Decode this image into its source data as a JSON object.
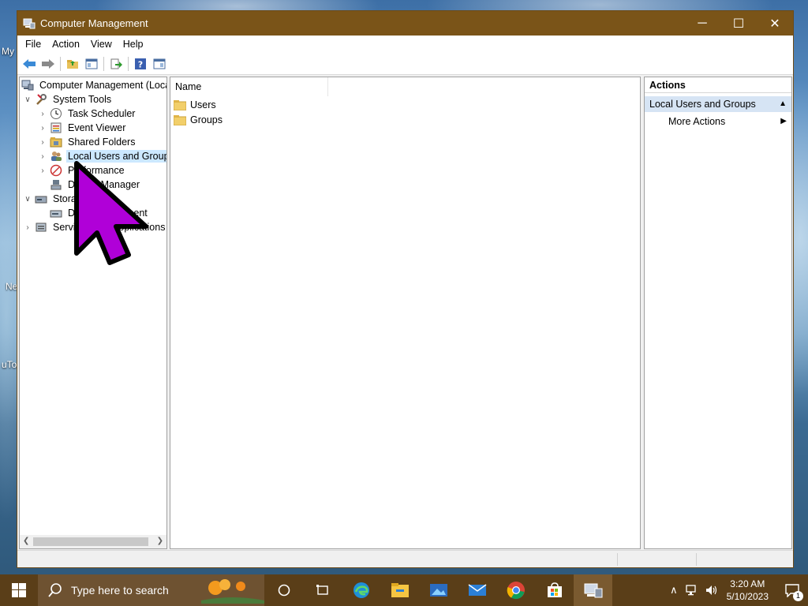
{
  "desktop": {
    "fragments": [
      "My",
      "Ne",
      "uTo"
    ]
  },
  "window": {
    "title": "Computer Management",
    "controls": {
      "minimize": "─",
      "maximize": "☐",
      "close": "✕"
    }
  },
  "menu": [
    "File",
    "Action",
    "View",
    "Help"
  ],
  "tree": {
    "root": "Computer Management (Local",
    "system_tools": "System Tools",
    "task_scheduler": "Task Scheduler",
    "event_viewer": "Event Viewer",
    "shared_folders": "Shared Folders",
    "local_users_groups": "Local Users and Groups",
    "performance": "Performance",
    "device_manager": "Device Manager",
    "storage": "Storage",
    "disk_management": "Disk Management",
    "services": "Services and Applications"
  },
  "center": {
    "column_name": "Name",
    "items": [
      "Users",
      "Groups"
    ]
  },
  "actions": {
    "header": "Actions",
    "group": "Local Users and Groups",
    "more": "More Actions"
  },
  "taskbar": {
    "search_placeholder": "Type here to search",
    "time": "3:20 AM",
    "date": "5/10/2023",
    "notification_count": "1"
  },
  "colors": {
    "titlebar": "#7a5418",
    "taskbar": "#5a3e18",
    "selection": "#cce8ff",
    "actions_group": "#d6e4f4",
    "cursor": "#b000d8"
  }
}
